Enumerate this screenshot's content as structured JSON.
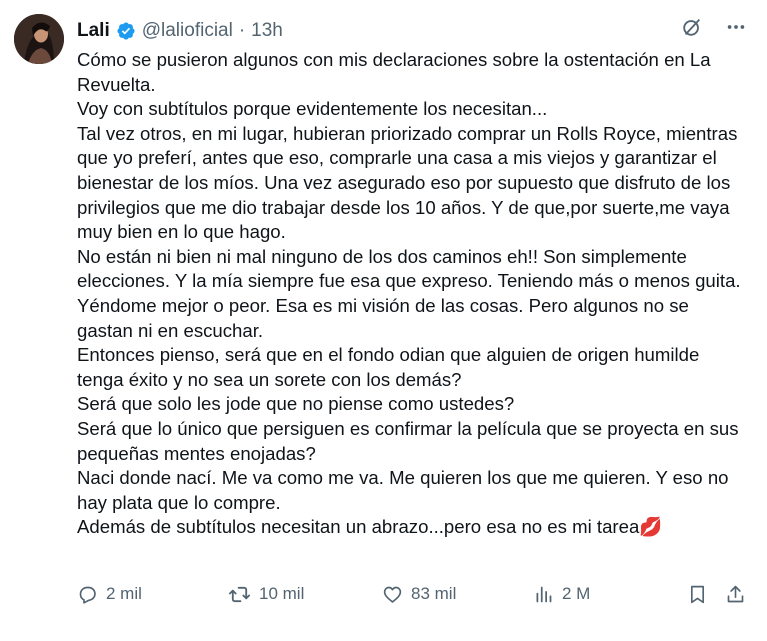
{
  "author": {
    "display_name": "Lali",
    "handle": "@lalioficial",
    "separator": "·",
    "time": "13h"
  },
  "tweet": {
    "lines": [
      "Cómo se pusieron algunos con mis declaraciones sobre la ostentación en La Revuelta.",
      "Voy con subtítulos porque evidentemente los necesitan...",
      "Tal vez otros, en mi lugar, hubieran priorizado comprar un Rolls Royce, mientras que yo preferí, antes que eso, comprarle una casa a mis viejos y garantizar el bienestar de los míos. Una vez asegurado eso por supuesto que disfruto de los privilegios que me dio trabajar desde los 10 años. Y de que,por suerte,me vaya muy bien en lo que hago.",
      "No están ni bien ni mal ninguno de los dos caminos eh!! Son simplemente elecciones. Y la mía siempre fue esa que expreso. Teniendo más o menos guita. Yéndome mejor o peor. Esa es mi visión de las cosas. Pero algunos no se gastan ni en escuchar.",
      "Entonces pienso, será que en el fondo odian que alguien de origen humilde tenga éxito y no sea un sorete con los demás?",
      "Será que solo les jode que no piense como ustedes?",
      "Será que lo único que persiguen es confirmar la película que se proyecta en sus pequeñas mentes enojadas?",
      "Naci donde nací. Me va como me va. Me quieren los que me quieren. Y eso no hay plata que lo compre.",
      "Además de subtítulos necesitan un abrazo...pero esa no es mi tarea💋"
    ]
  },
  "stats": {
    "replies": "2 mil",
    "retweets": "10 mil",
    "likes": "83 mil",
    "views": "2 M"
  },
  "icons": {
    "verified": "verified-badge-icon",
    "grok": "grok-icon",
    "more": "more-icon",
    "reply": "reply-icon",
    "retweet": "retweet-icon",
    "like": "heart-icon",
    "views": "views-icon",
    "bookmark": "bookmark-icon",
    "share": "share-icon"
  },
  "colors": {
    "text": "#0f1419",
    "secondary": "#536471",
    "verified": "#1d9bf0"
  }
}
